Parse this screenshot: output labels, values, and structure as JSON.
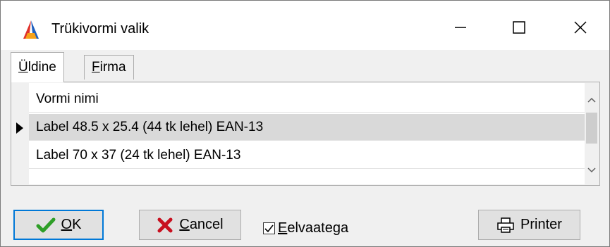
{
  "window": {
    "title": "Trükivormi valik",
    "controls": {
      "minimize_icon": "minimize-icon",
      "maximize_icon": "maximize-icon",
      "close_icon": "close-icon"
    }
  },
  "tabs": [
    {
      "label_hotkey": "Ü",
      "label_rest": "ldine",
      "active": true
    },
    {
      "label_hotkey": "F",
      "label_rest": "irma",
      "active": false
    }
  ],
  "grid": {
    "column_header": "Vormi nimi",
    "rows": [
      {
        "name": "Label 48.5 x 25.4 (44 tk lehel) EAN-13",
        "selected": true
      },
      {
        "name": "Label 70 x 37 (24 tk lehel) EAN-13",
        "selected": false
      }
    ]
  },
  "buttons": {
    "ok_hotkey": "O",
    "ok_rest": "K",
    "cancel_hotkey": "C",
    "cancel_rest": "ancel",
    "printer_label": "Printer"
  },
  "preview_checkbox": {
    "label_hotkey": "E",
    "label_rest": "elvaatega",
    "checked": true
  },
  "colors": {
    "accent": "#0078d7",
    "ok_check": "#2e9e27",
    "cancel_x": "#c8101f",
    "selected_row": "#d9d9d9"
  }
}
